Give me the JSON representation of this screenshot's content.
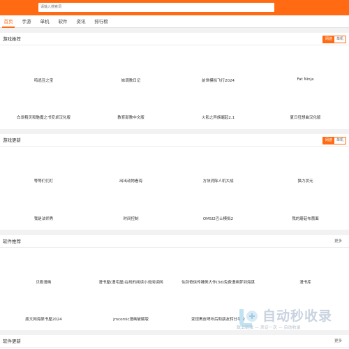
{
  "search": {
    "placeholder": "请输入搜索词"
  },
  "nav": [
    {
      "label": "首页"
    },
    {
      "label": "手游"
    },
    {
      "label": "单机"
    },
    {
      "label": "软件"
    },
    {
      "label": "资讯"
    },
    {
      "label": "排行榜"
    }
  ],
  "toggle": {
    "on": "网游",
    "off": "单机"
  },
  "more_label": "更多",
  "sections": [
    {
      "title": "游戏推荐",
      "items": [
        "鸣逃豆之宝",
        "妹调教日记",
        "前世模拟飞行2024",
        "Fat Ninja",
        "白发精灵和魅魔之书安卓汉化版",
        "教育部教中文版",
        "火影之异族崛起2.1",
        "夏日狂想曲汉化版"
      ]
    },
    {
      "title": "游戏更新",
      "items": [
        "等等们们灯",
        "出出动物看海",
        "方块消除人机大战",
        "猫力状元",
        "我是法师秀",
        "时间控制",
        "OMSI2巴士模拟2",
        "我的蘑菇布蕾面"
      ]
    },
    {
      "title": "软件推荐",
      "items": [
        "贝勒漫画",
        "漫书屋(漫宅屋)在线的阅读小说阅读网",
        "仙剑奇侠传睡美大作(3d)免费漫画梦到海谋",
        "漫书库",
        "废文网海棠书屋2024",
        "jmcomic漫画破解版",
        "变现黑皮啤咔后和朋友转分平台",
        ""
      ]
    },
    {
      "title": "软件更新"
    }
  ],
  "watermark": {
    "text": "自动秒收录",
    "sub": "致上链接 — 来访一次 — 自动收录"
  },
  "colors": {
    "accent": "#ff6a13"
  }
}
